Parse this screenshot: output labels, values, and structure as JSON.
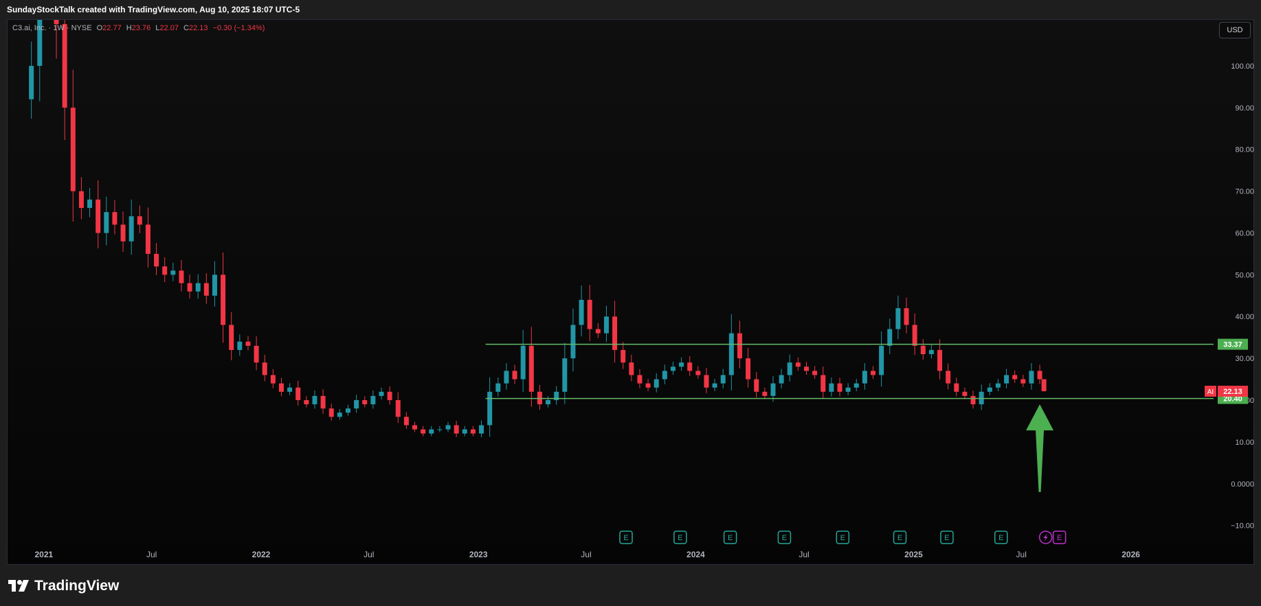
{
  "header": {
    "attribution": "SundayStockTalk created with TradingView.com, Aug 10, 2025 18:07 UTC-5"
  },
  "legend": {
    "symbol": "C3.ai, Inc. · 1W · NYSE",
    "open_label": "O",
    "open": "22.77",
    "high_label": "H",
    "high": "23.76",
    "low_label": "L",
    "low": "22.07",
    "close_label": "C",
    "close": "22.13",
    "change": "−0.30 (−1.34%)"
  },
  "currency_button": "USD",
  "footer": {
    "brand": "TradingView"
  },
  "colors": {
    "up": "#2196a6",
    "down": "#f23645",
    "level_line": "#66bb6a",
    "arrow": "#4caf50",
    "earnings": "#26a69a",
    "dividend": "#c030d0"
  },
  "chart_data": {
    "type": "candlestick",
    "title": "",
    "xlabel": "",
    "ylabel": "",
    "timeframe": "1W",
    "x_axis_labels": [
      "2021",
      "Jul",
      "2022",
      "Jul",
      "2023",
      "Jul",
      "2024",
      "Jul",
      "2025",
      "Jul",
      "2026"
    ],
    "x_axis_dates": [
      "2021-01-01",
      "2021-07-01",
      "2022-01-01",
      "2022-07-01",
      "2023-01-01",
      "2023-07-01",
      "2024-01-01",
      "2024-07-01",
      "2025-01-01",
      "2025-07-01",
      "2026-01-01"
    ],
    "y_ticks": [
      -10,
      0,
      10,
      20,
      30,
      40,
      50,
      60,
      70,
      80,
      90,
      100
    ],
    "y_tick_labels": [
      "−10.00",
      "0.0000",
      "10.00",
      "20.00",
      "30.00",
      "40.00",
      "50.00",
      "60.00",
      "70.00",
      "80.00",
      "90.00",
      "100.00"
    ],
    "ylim": [
      -14,
      111
    ],
    "xlim": [
      "2020-11-01",
      "2026-05-20"
    ],
    "grid": false,
    "close_series": {
      "dates": [
        "2020-12-11",
        "2020-12-25",
        "2021-01-08",
        "2021-01-22",
        "2021-02-05",
        "2021-02-19",
        "2021-03-05",
        "2021-03-19",
        "2021-04-02",
        "2021-04-16",
        "2021-04-30",
        "2021-05-14",
        "2021-05-28",
        "2021-06-11",
        "2021-06-25",
        "2021-07-09",
        "2021-07-23",
        "2021-08-06",
        "2021-08-20",
        "2021-09-03",
        "2021-09-17",
        "2021-10-01",
        "2021-10-15",
        "2021-10-29",
        "2021-11-12",
        "2021-11-26",
        "2021-12-10",
        "2021-12-24",
        "2022-01-07",
        "2022-01-21",
        "2022-02-04",
        "2022-02-18",
        "2022-03-04",
        "2022-03-18",
        "2022-04-01",
        "2022-04-15",
        "2022-04-29",
        "2022-05-13",
        "2022-05-27",
        "2022-06-10",
        "2022-06-24",
        "2022-07-08",
        "2022-07-22",
        "2022-08-05",
        "2022-08-19",
        "2022-09-02",
        "2022-09-16",
        "2022-09-30",
        "2022-10-14",
        "2022-10-28",
        "2022-11-11",
        "2022-11-25",
        "2022-12-09",
        "2022-12-23",
        "2023-01-06",
        "2023-01-20",
        "2023-02-03",
        "2023-02-17",
        "2023-03-03",
        "2023-03-17",
        "2023-03-31",
        "2023-04-14",
        "2023-04-28",
        "2023-05-12",
        "2023-05-26",
        "2023-06-09",
        "2023-06-23",
        "2023-07-07",
        "2023-07-21",
        "2023-08-04",
        "2023-08-18",
        "2023-09-01",
        "2023-09-15",
        "2023-09-29",
        "2023-10-13",
        "2023-10-27",
        "2023-11-10",
        "2023-11-24",
        "2023-12-08",
        "2023-12-22",
        "2024-01-05",
        "2024-01-19",
        "2024-02-02",
        "2024-02-16",
        "2024-03-01",
        "2024-03-15",
        "2024-03-29",
        "2024-04-12",
        "2024-04-26",
        "2024-05-10",
        "2024-05-24",
        "2024-06-07",
        "2024-06-21",
        "2024-07-05",
        "2024-07-19",
        "2024-08-02",
        "2024-08-16",
        "2024-08-30",
        "2024-09-13",
        "2024-09-27",
        "2024-10-11",
        "2024-10-25",
        "2024-11-08",
        "2024-11-22",
        "2024-12-06",
        "2024-12-20",
        "2025-01-03",
        "2025-01-17",
        "2025-01-31",
        "2025-02-14",
        "2025-02-28",
        "2025-03-14",
        "2025-03-28",
        "2025-04-11",
        "2025-04-25",
        "2025-05-09",
        "2025-05-23",
        "2025-06-06",
        "2025-06-20",
        "2025-07-04",
        "2025-07-18",
        "2025-08-01",
        "2025-08-08"
      ],
      "close": [
        100,
        120,
        130,
        110,
        90,
        70,
        66,
        68,
        60,
        65,
        62,
        58,
        64,
        62,
        55,
        52,
        50,
        51,
        48,
        46,
        48,
        45,
        50,
        38,
        32,
        34,
        33,
        29,
        26,
        24,
        22,
        23,
        20,
        19,
        21,
        18,
        16,
        17,
        18,
        20,
        19,
        21,
        22,
        20,
        16,
        14,
        13,
        12,
        13,
        13,
        14,
        12,
        13,
        12,
        14,
        22,
        24,
        27,
        25,
        33,
        22,
        19,
        20,
        22,
        30,
        38,
        44,
        37,
        36,
        40,
        32,
        29,
        26,
        24,
        23,
        25,
        27,
        28,
        29,
        27,
        26,
        23,
        24,
        26,
        36,
        30,
        25,
        22,
        21,
        24,
        26,
        29,
        28,
        27,
        26,
        22,
        24,
        22,
        23,
        24,
        27,
        26,
        33,
        37,
        42,
        38,
        33,
        31,
        32,
        27,
        24,
        22,
        21,
        19,
        22,
        23,
        24,
        26,
        25,
        24,
        27,
        25,
        22.13
      ]
    },
    "latest": {
      "open": 22.77,
      "high": 23.76,
      "low": 22.07,
      "close": 22.13
    },
    "support_line": {
      "value": 20.4,
      "label": "20.40",
      "start_date": "2023-01-13"
    },
    "resistance_line": {
      "value": 33.37,
      "label": "33.37",
      "start_date": "2023-01-13"
    },
    "price_tag": {
      "symbol": "AI",
      "value": 22.13,
      "label": "22.13"
    },
    "earnings_markers": {
      "dates": [
        "2023-09-06",
        "2023-12-06",
        "2024-02-28",
        "2024-05-29",
        "2024-09-04",
        "2024-12-09",
        "2025-02-26",
        "2025-05-28",
        "2025-09-03"
      ],
      "label": "E"
    },
    "arrow": {
      "date": "2025-08-01",
      "from_value": -2,
      "to_value": 19
    }
  }
}
